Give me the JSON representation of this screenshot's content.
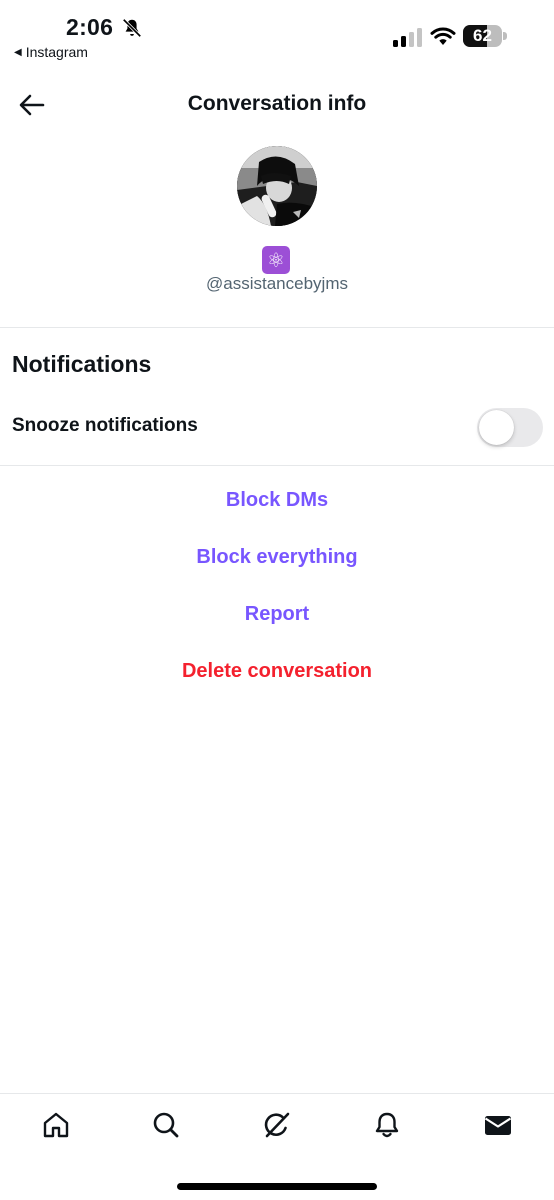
{
  "status_bar": {
    "time": "2:06",
    "back_app": "Instagram",
    "back_arrow_glyph": "◀",
    "battery_level": "62",
    "battery_fraction": 0.62,
    "icons": [
      "bell-slash-icon",
      "cellular-signal-icon",
      "wifi-icon",
      "battery-icon"
    ]
  },
  "header": {
    "title": "Conversation info",
    "back_icon": "arrow-left-icon"
  },
  "profile": {
    "emoji": "⚛",
    "handle": "@assistancebyjms"
  },
  "notifications": {
    "title": "Notifications",
    "snooze_label": "Snooze notifications",
    "snooze_on": false
  },
  "actions": {
    "block_dms": "Block DMs",
    "block_everything": "Block everything",
    "report": "Report",
    "delete_conversation": "Delete conversation"
  },
  "bottom_nav": {
    "items": [
      "home-icon",
      "search-icon",
      "grok-icon",
      "notifications-bell-icon",
      "messages-envelope-icon"
    ]
  },
  "colors": {
    "accent": "#7856ff",
    "danger": "#f4212e",
    "secondary_text": "#536471",
    "emoji_bg": "#9c4fd6"
  }
}
